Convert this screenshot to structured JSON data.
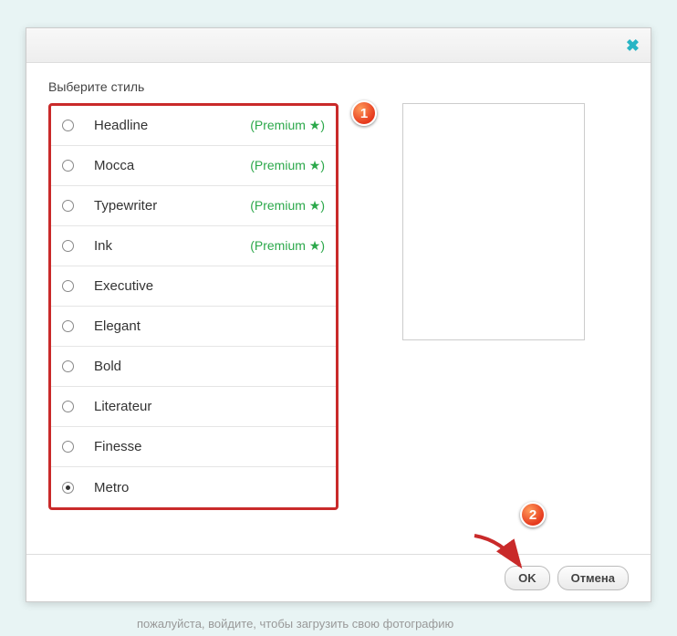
{
  "title": "Выберите стиль",
  "close_glyph": "✖",
  "styles": [
    {
      "name": "Headline",
      "premium": true,
      "selected": false
    },
    {
      "name": "Mocca",
      "premium": true,
      "selected": false
    },
    {
      "name": "Typewriter",
      "premium": true,
      "selected": false
    },
    {
      "name": "Ink",
      "premium": true,
      "selected": false
    },
    {
      "name": "Executive",
      "premium": false,
      "selected": false
    },
    {
      "name": "Elegant",
      "premium": false,
      "selected": false
    },
    {
      "name": "Bold",
      "premium": false,
      "selected": false
    },
    {
      "name": "Literateur",
      "premium": false,
      "selected": false
    },
    {
      "name": "Finesse",
      "premium": false,
      "selected": false
    },
    {
      "name": "Metro",
      "premium": false,
      "selected": true
    }
  ],
  "premium_label": "(Premium ★)",
  "buttons": {
    "ok": "OK",
    "cancel": "Отмена"
  },
  "callouts": {
    "one": "1",
    "two": "2"
  },
  "bg_hint": "пожалуйста, войдите, чтобы загрузить свою фотографию"
}
